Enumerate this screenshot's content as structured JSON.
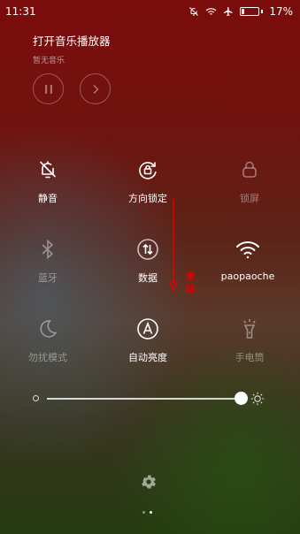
{
  "status_bar": {
    "time": "11:31",
    "battery_text": "17%",
    "battery_level": 0.17,
    "icons": [
      "bell-off-icon",
      "wifi-icon",
      "airplane-icon",
      "battery-icon"
    ]
  },
  "music": {
    "title": "打开音乐播放器",
    "subtitle": "暂无音乐",
    "controls": [
      "pause-icon",
      "next-icon"
    ]
  },
  "tiles": [
    {
      "label": "静音",
      "icon": "bell-off-icon",
      "active": true
    },
    {
      "label": "方向锁定",
      "icon": "rotation-lock-icon",
      "active": true
    },
    {
      "label": "锁屏",
      "icon": "lock-icon",
      "active": false
    },
    {
      "label": "蓝牙",
      "icon": "bluetooth-icon",
      "active": false
    },
    {
      "label": "数据",
      "icon": "data-icon",
      "active": true
    },
    {
      "label": "paopaoche",
      "icon": "wifi-icon",
      "active": true
    },
    {
      "label": "勿扰模式",
      "icon": "moon-icon",
      "active": false
    },
    {
      "label": "自动亮度",
      "icon": "auto-brightness-icon",
      "active": true
    },
    {
      "label": "手电筒",
      "icon": "flashlight-icon",
      "active": false
    }
  ],
  "annotation": {
    "text": "滑动",
    "color": "#e00000"
  },
  "brightness": {
    "level": 0.99
  },
  "pager": {
    "count": 2,
    "active": 1
  }
}
